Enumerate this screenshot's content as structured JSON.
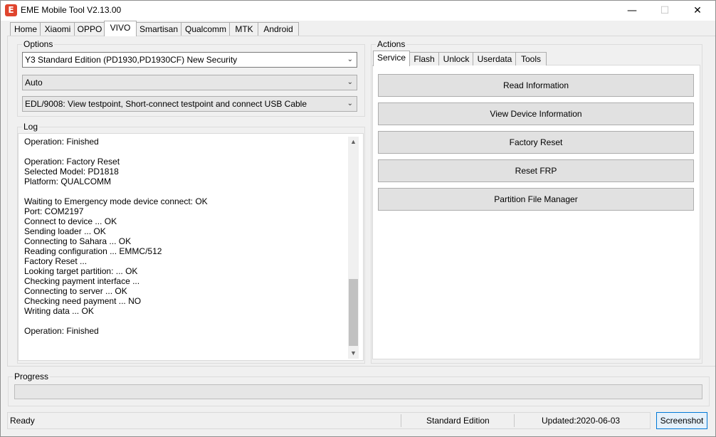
{
  "window": {
    "title": "EME Mobile Tool V2.13.00",
    "app_icon": "E",
    "controls": {
      "minimize": "—",
      "maximize": "☐",
      "close": "✕"
    }
  },
  "main_tabs": [
    "Home",
    "Xiaomi",
    "OPPO",
    "VIVO",
    "Smartisan",
    "Qualcomm",
    "MTK",
    "Android"
  ],
  "active_main_tab": "VIVO",
  "options": {
    "label": "Options",
    "model": "Y3 Standard Edition (PD1930,PD1930CF) New Security",
    "mode": "Auto",
    "connection": "EDL/9008: View testpoint, Short-connect testpoint and connect USB Cable"
  },
  "log": {
    "label": "Log",
    "text": "Operation: Finished\n\nOperation: Factory Reset\nSelected Model: PD1818\nPlatform: QUALCOMM\n\nWaiting to Emergency mode device connect: OK\nPort: COM2197\nConnect to device ... OK\nSending loader ... OK\nConnecting to Sahara ... OK\nReading configuration ... EMMC/512\nFactory Reset ...\nLooking target partition: ... OK\nChecking payment interface ...\nConnecting to server ... OK\nChecking need payment ... NO\nWriting data ... OK\n\nOperation: Finished"
  },
  "actions": {
    "label": "Actions",
    "tabs": [
      "Service",
      "Flash",
      "Unlock",
      "Userdata",
      "Tools"
    ],
    "active_tab": "Service",
    "buttons": [
      "Read Information",
      "View Device Information",
      "Factory Reset",
      "Reset FRP",
      "Partition File Manager"
    ]
  },
  "progress": {
    "label": "Progress",
    "value": 0
  },
  "status": {
    "state": "Ready",
    "edition": "Standard Edition",
    "updated": "Updated:2020-06-03",
    "screenshot_label": "Screenshot"
  },
  "colors": {
    "accent": "#0078d7",
    "app_icon": "#e0452e",
    "progress": "#06b025"
  }
}
